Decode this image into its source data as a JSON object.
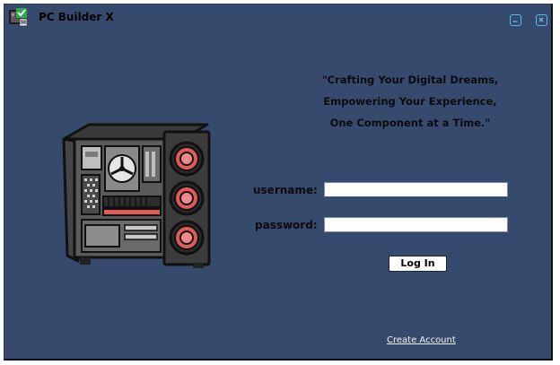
{
  "window": {
    "title": "PC Builder X",
    "app_icon": "pc-builder-icon",
    "controls": {
      "minimize_icon": "minimize-icon",
      "close_icon": "close-icon"
    }
  },
  "colors": {
    "background": "#364a6e",
    "accent": "#5cb7ea",
    "fan_red": "#e05a5a"
  },
  "tagline": {
    "line1": "\"Crafting Your Digital Dreams,",
    "line2": "Empowering Your Experience,",
    "line3": "One Component at a Time.\""
  },
  "illustration": {
    "icon": "pc-case-icon"
  },
  "login_form": {
    "username_label": "username:",
    "username_value": "",
    "password_label": "password:",
    "password_value": "",
    "login_button": "Log In",
    "create_account_link": "Create Account"
  }
}
